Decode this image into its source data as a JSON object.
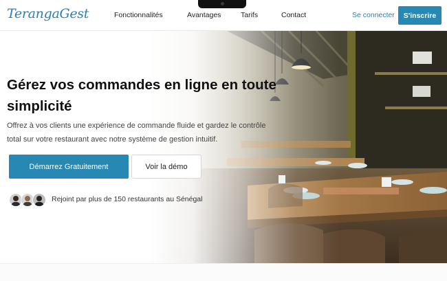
{
  "header": {
    "logo": "TerangaGest",
    "nav": [
      "Fonctionnalités",
      "Avantages",
      "Tarifs",
      "Contact"
    ],
    "login": "Se connecter",
    "signup": "S'inscrire"
  },
  "hero": {
    "title": "Gérez vos commandes en ligne en toute simplicité",
    "subtitle": "Offrez à vos clients une expérience de commande fluide et gardez le contrôle total sur votre restaurant avec notre système de gestion intuitif.",
    "cta_primary": "Démarrez Gratuitement",
    "cta_secondary": "Voir la démo",
    "social_proof": "Rejoint par plus de 150 restaurants au Sénégal"
  },
  "colors": {
    "accent": "#2789b3",
    "logo": "#2b7fb0"
  },
  "icons": [
    "avatar",
    "avatar",
    "avatar"
  ]
}
